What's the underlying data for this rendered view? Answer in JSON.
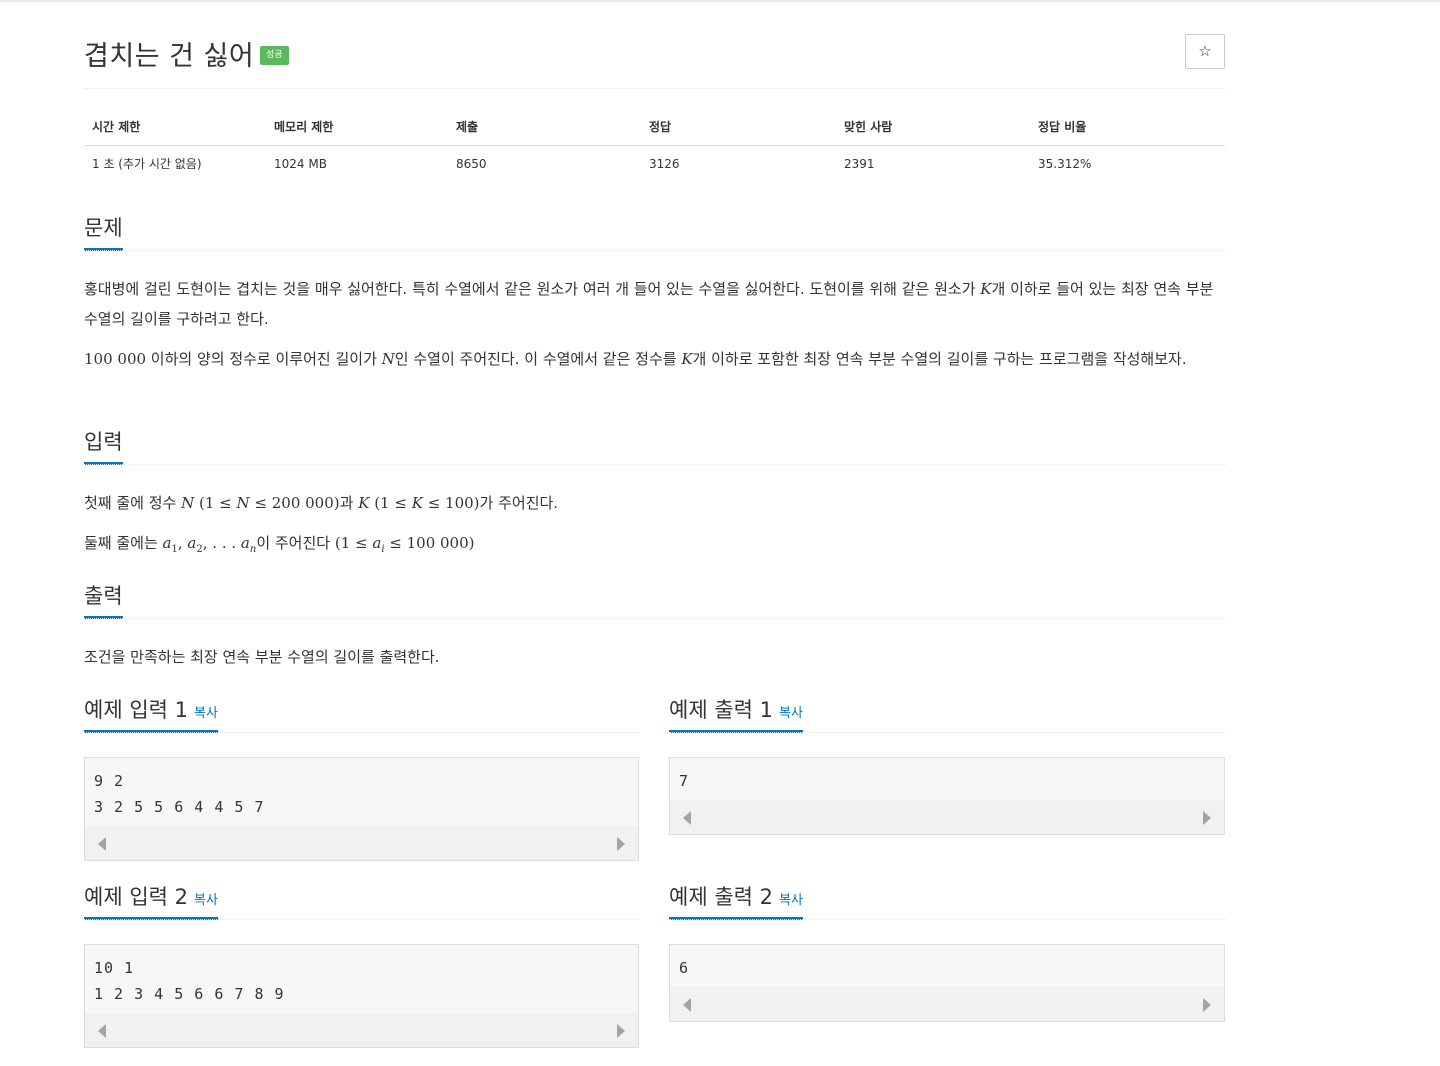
{
  "problem": {
    "title": "겹치는 건 싫어",
    "badge": "성공",
    "star": "☆"
  },
  "info_table": {
    "headers": [
      "시간 제한",
      "메모리 제한",
      "제출",
      "정답",
      "맞힌 사람",
      "정답 비율"
    ],
    "values": [
      "1 초 (추가 시간 없음)",
      "1024 MB",
      "8650",
      "3126",
      "2391",
      "35.312%"
    ]
  },
  "sections": {
    "problem": "문제",
    "input": "입력",
    "output": "출력"
  },
  "problem_text": {
    "p1a": "홍대병에 걸린 도현이는 겹치는 것을 매우 싫어한다. 특히 수열에서 같은 원소가 여러 개 들어 있는 수열을 싫어한다. 도현이를 위해 같은 원소가 ",
    "p1k": "K",
    "p1b": "개 이하로 들어 있는 최장 연속 부분 수열의 길이를 구하려고 한다.",
    "p2num": "100 000",
    "p2a": " 이하의 양의 정수로 이루어진 길이가 ",
    "p2n": "N",
    "p2b": "인 수열이 주어진다.  이 수열에서 같은 정수를 ",
    "p2k": "K",
    "p2c": "개 이하로 포함한 최장 연속 부분 수열의 길이를 구하는 프로그램을 작성해보자."
  },
  "input_text": {
    "l1a": "첫째 줄에 정수 ",
    "l1b": "N",
    "l1c": " (1 ≤ ",
    "l1d": "N",
    "l1e": " ≤ 200 000)",
    "l1f": "과 ",
    "l1g": "K",
    "l1h": " (1 ≤ ",
    "l1i": "K",
    "l1j": " ≤ 100)",
    "l1k": "가 주어진다.",
    "l2a": "둘째 줄에는 ",
    "l2b": "a",
    "l2c": "1",
    "l2d": ", ",
    "l2e": "a",
    "l2f": "2",
    "l2g": ", . . . ",
    "l2h": "a",
    "l2i": "n",
    "l2j": "이 주어진다 ",
    "l2k": "(1 ≤ ",
    "l2l": "a",
    "l2m": "i",
    "l2n": " ≤ 100 000)"
  },
  "output_text": "조건을 만족하는 최장 연속 부분 수열의 길이를 출력한다.",
  "samples": [
    {
      "in_title": "예제 입력 1",
      "in_copy": "복사",
      "in_data": "9 2\n3 2 5 5 6 4 4 5 7",
      "out_title": "예제 출력 1",
      "out_copy": "복사",
      "out_data": "7"
    },
    {
      "in_title": "예제 입력 2",
      "in_copy": "복사",
      "in_data": "10 1\n1 2 3 4 5 6 6 7 8 9",
      "out_title": "예제 출력 2",
      "out_copy": "복사",
      "out_data": "6"
    }
  ]
}
